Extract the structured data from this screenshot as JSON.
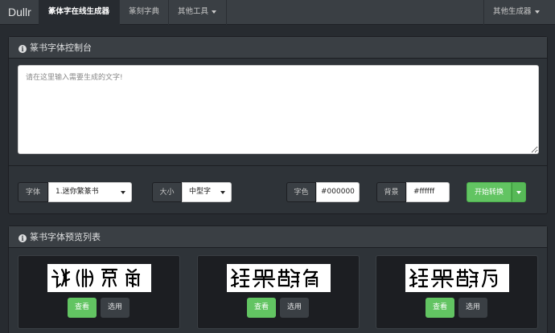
{
  "navbar": {
    "brand": "Dullr",
    "items": [
      {
        "label": "篆体字在线生成器"
      },
      {
        "label": "篆刻字典"
      },
      {
        "label": "其他工具"
      }
    ],
    "right_menu": "其他生成器"
  },
  "control_panel": {
    "title": "篆书字体控制台",
    "textarea_placeholder": "请在这里输入需要生成的文字!",
    "font_label": "字体",
    "font_value": "1.迷你繁篆书",
    "size_label": "大小",
    "size_value": "中型字",
    "color_label": "字色",
    "color_value": "#000000",
    "bg_label": "背景",
    "bg_value": "#ffffff",
    "convert_button": "开始转换"
  },
  "preview_panel": {
    "title": "篆书字体预览列表",
    "cards": [
      {
        "view_label": "查看",
        "select_label": "选用"
      },
      {
        "view_label": "查看",
        "select_label": "选用"
      },
      {
        "view_label": "查看",
        "select_label": "选用"
      }
    ]
  },
  "colors": {
    "background": "#272b30",
    "navbar": "#3a3f44",
    "success": "#62c462"
  }
}
